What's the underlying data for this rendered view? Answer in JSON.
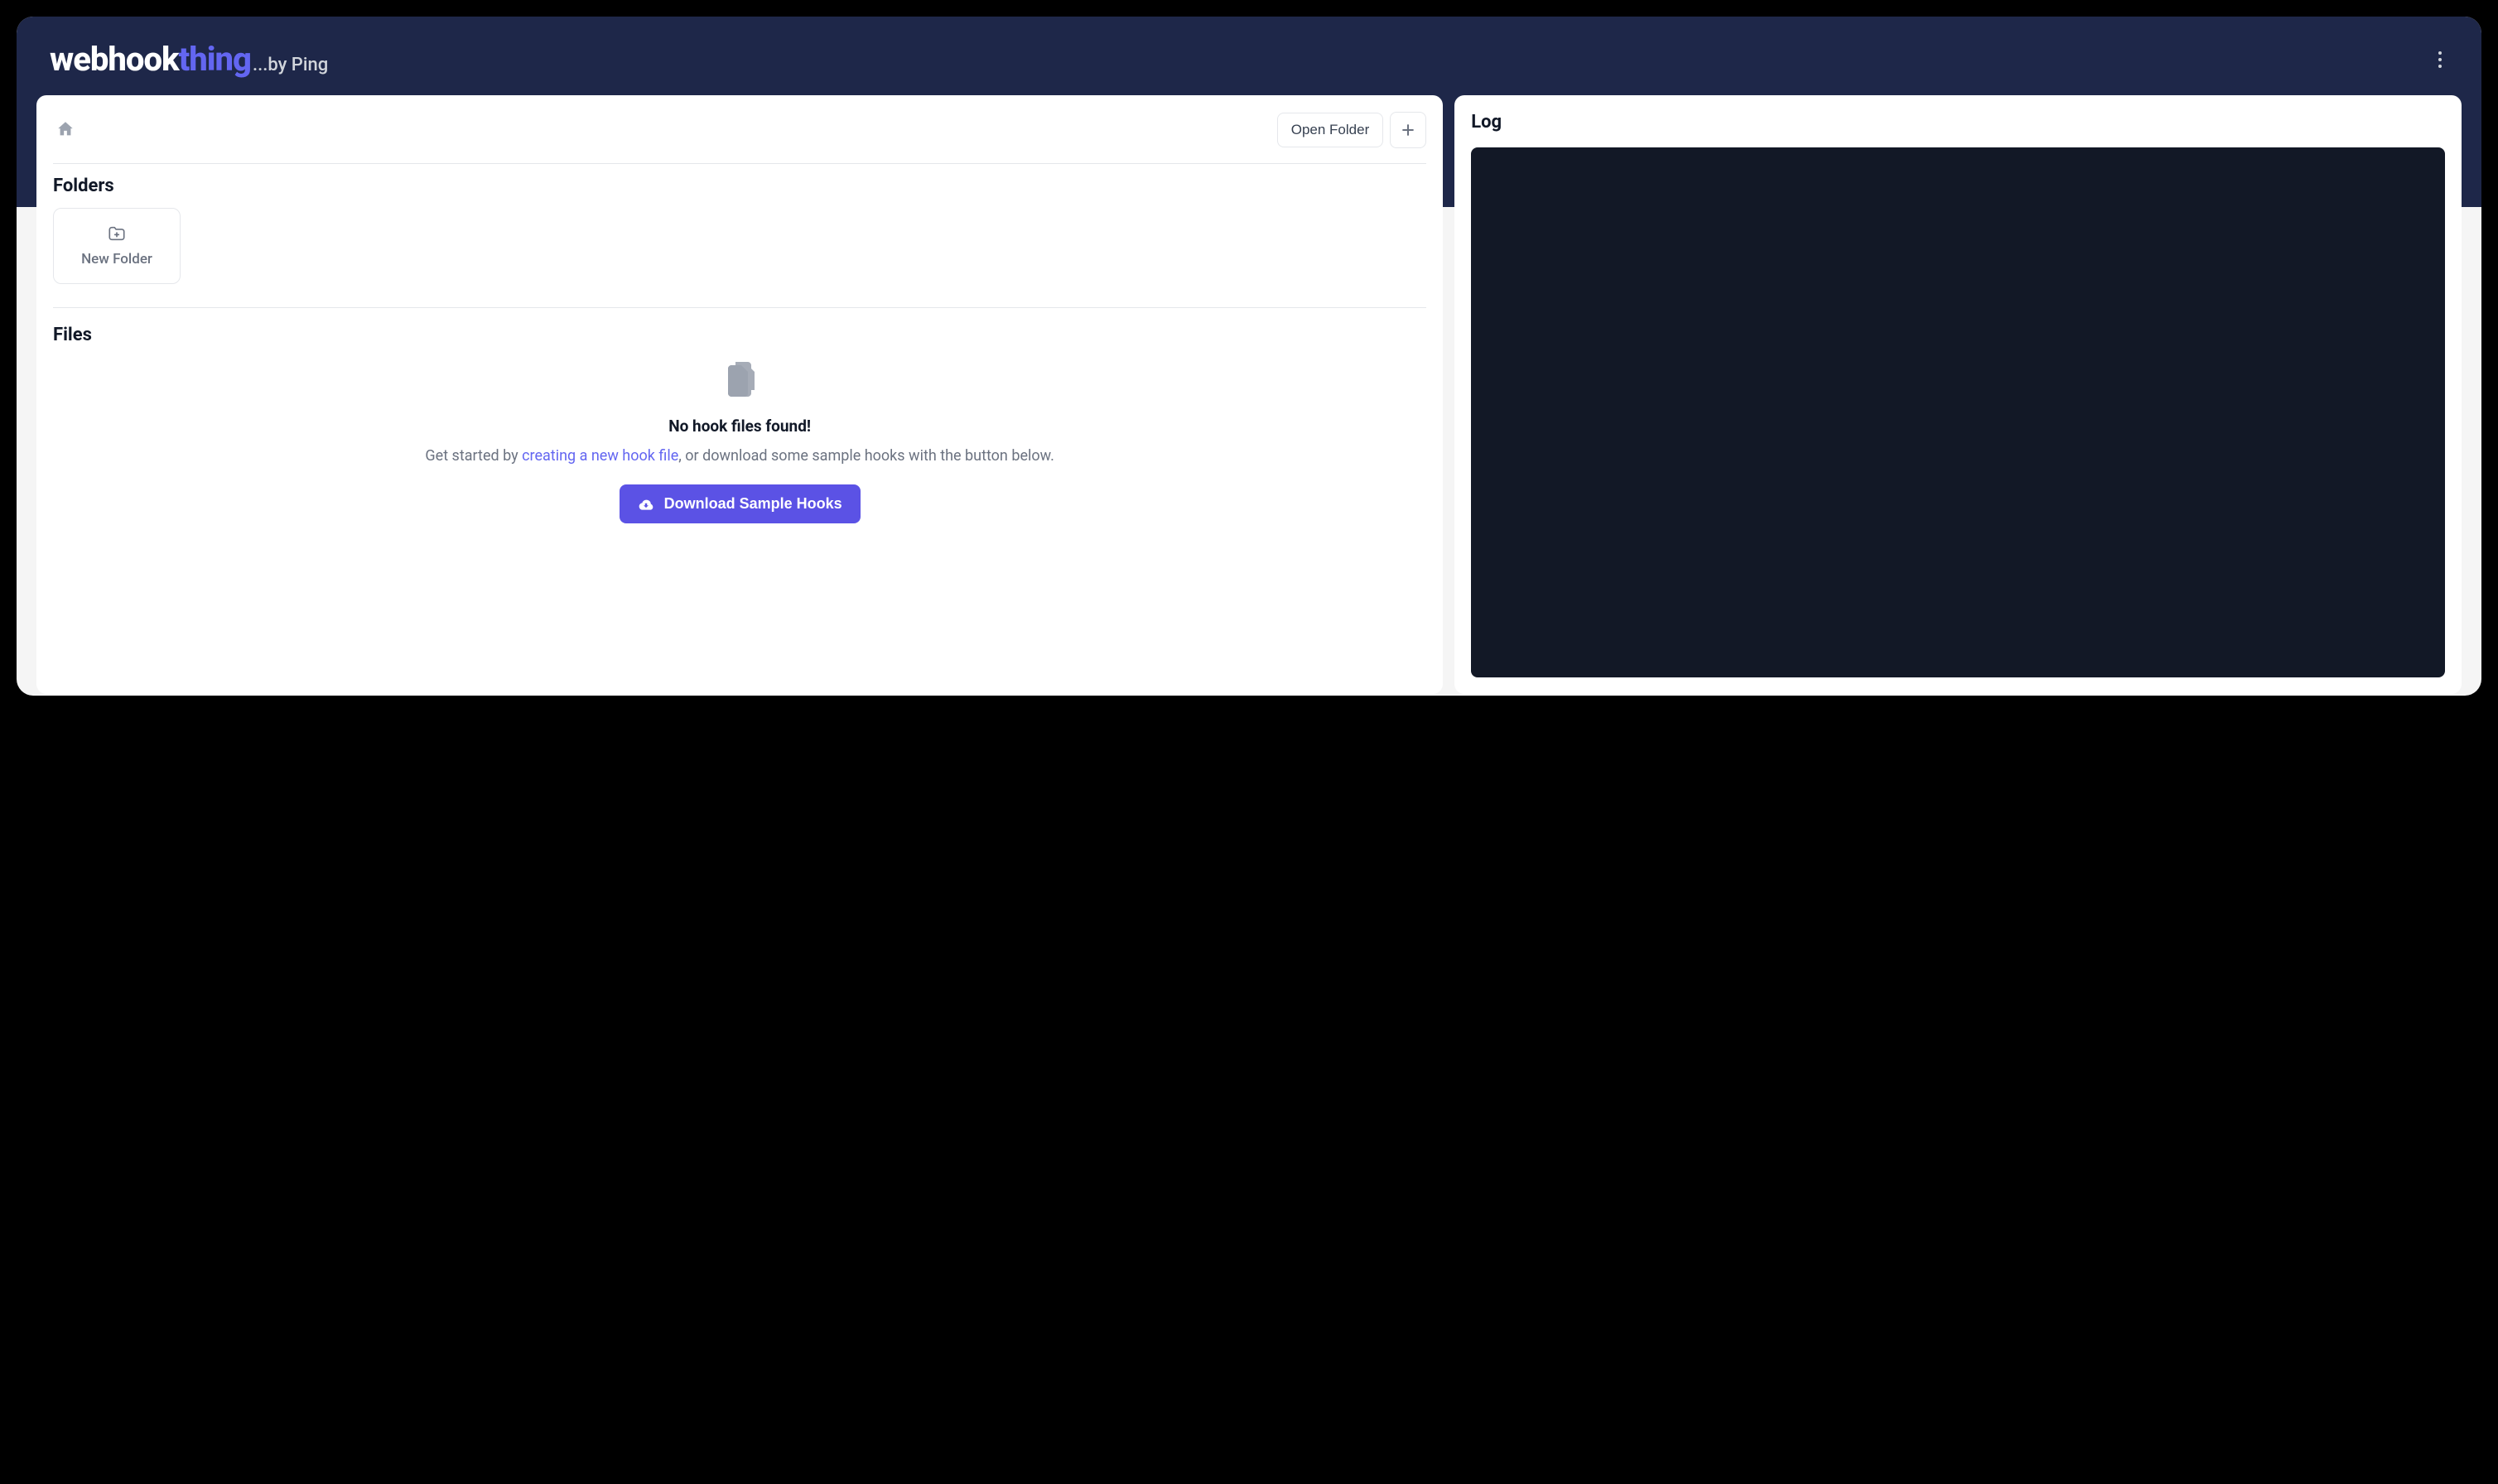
{
  "header": {
    "logo_primary": "webhook",
    "logo_secondary": "thing",
    "logo_tagline": "...by Ping"
  },
  "toolbar": {
    "open_folder_label": "Open Folder"
  },
  "folders_section": {
    "title": "Folders",
    "new_folder_label": "New Folder"
  },
  "files_section": {
    "title": "Files",
    "empty_title": "No hook files found!",
    "empty_prefix": "Get started by ",
    "empty_link": "creating a new hook file",
    "empty_suffix": ", or download some sample hooks with the button below.",
    "download_label": "Download Sample Hooks"
  },
  "log_section": {
    "title": "Log"
  }
}
